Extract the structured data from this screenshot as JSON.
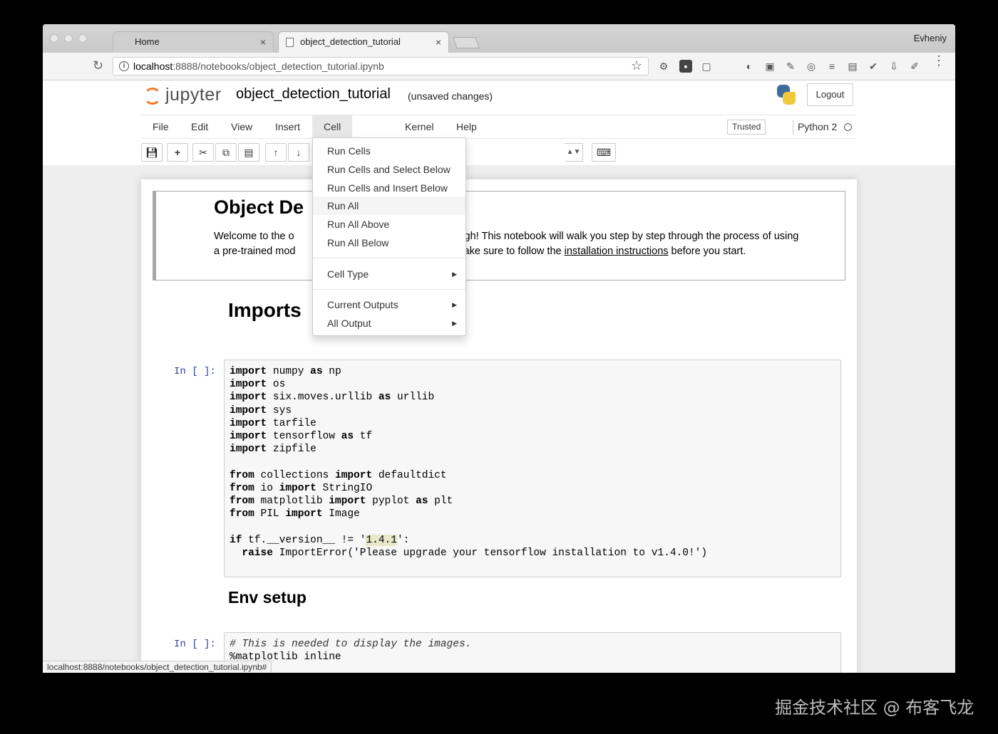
{
  "browser": {
    "tabs": [
      {
        "label": "Home"
      },
      {
        "label": "object_detection_tutorial"
      }
    ],
    "tab_close_glyph": "×",
    "profile_name": "Evheniy",
    "url_host": "localhost",
    "url_rest": ":8888/notebooks/object_detection_tutorial.ipynb",
    "status_url": "localhost:8888/notebooks/object_detection_tutorial.ipynb#"
  },
  "header": {
    "logo_text": "jupyter",
    "notebook_name": "object_detection_tutorial",
    "save_status": "(unsaved changes)",
    "logout_label": "Logout"
  },
  "menubar": {
    "items": [
      "File",
      "Edit",
      "View",
      "Insert",
      "Cell",
      "Kernel",
      "Help"
    ],
    "trusted_label": "Trusted",
    "kernel_name": "Python 2"
  },
  "cell_menu": {
    "group1": [
      "Run Cells",
      "Run Cells and Select Below",
      "Run Cells and Insert Below",
      "Run All",
      "Run All Above",
      "Run All Below"
    ],
    "group2": [
      "Cell Type"
    ],
    "group3": [
      "Current Outputs",
      "All Output"
    ],
    "hovered": "Run All"
  },
  "notebook": {
    "intro_title": "Object De",
    "intro_line1_a": "Welcome to the o",
    "intro_line1_b": "rough! This notebook will walk you step by step through the process of using",
    "intro_line2_a": "a pre-trained mod",
    "intro_line2_b": " Make sure to follow the ",
    "intro_link": "installation instructions",
    "intro_line2_c": " before you start.",
    "imports_heading": "Imports",
    "env_heading": "Env setup",
    "prompt_label": "In [ ]:"
  },
  "watermark": "掘金技术社区 @ 布客飞龙",
  "colors": {
    "jupyter_orange": "#f37726",
    "prompt_blue": "#303f9f",
    "python_blue": "#3d6e99",
    "python_yellow": "#f0c83b"
  }
}
